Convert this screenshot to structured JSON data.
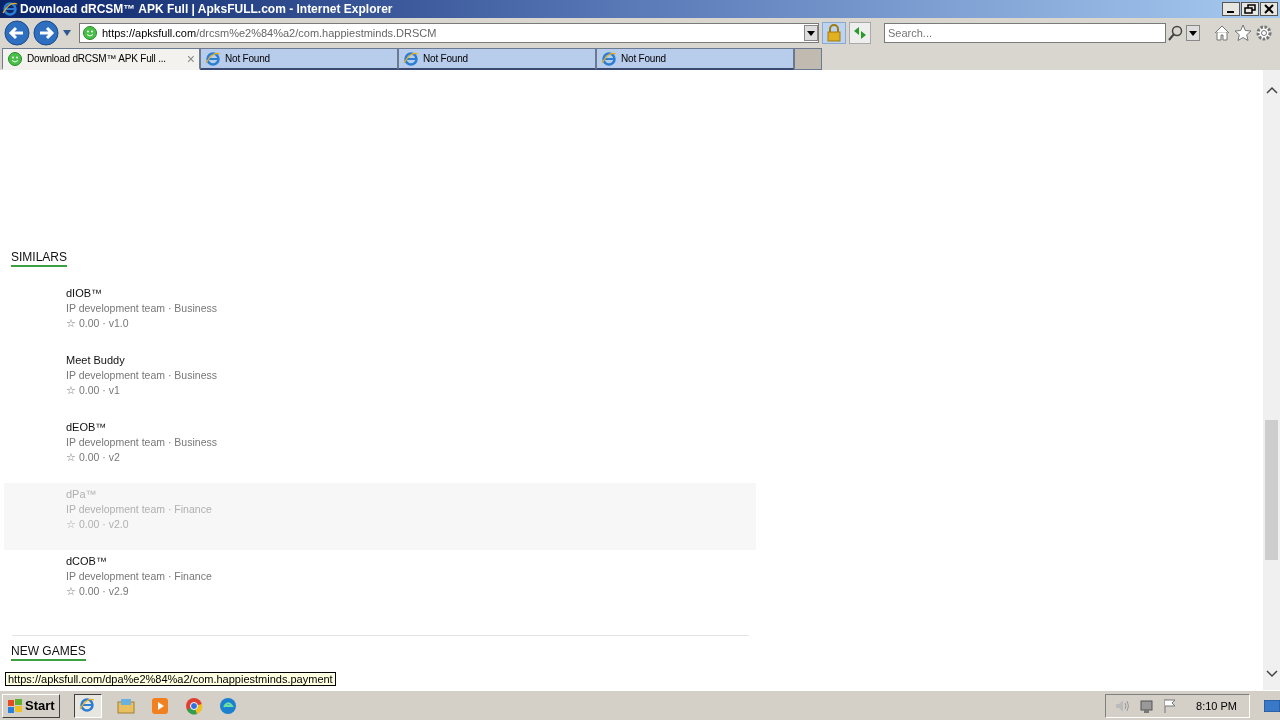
{
  "window": {
    "title": "Download dRCSM™ APK Full | ApksFULL.com - Internet Explorer"
  },
  "address": {
    "host": "https://apksfull.com",
    "path": "/drcsm%e2%84%a2/com.happiestminds.DRSCM"
  },
  "search": {
    "placeholder": "Search..."
  },
  "tabs": [
    {
      "label": "Download dRCSM™ APK Full ...",
      "selected": true,
      "close": "×"
    },
    {
      "label": "Not Found",
      "selected": false
    },
    {
      "label": "Not Found",
      "selected": false
    },
    {
      "label": "Not Found",
      "selected": false
    }
  ],
  "similars": {
    "heading": "SIMILARS",
    "items": [
      {
        "name": "dIOB™",
        "meta": "IP development team · Business",
        "rating": "☆ 0.00 · v1.0",
        "hovered": false
      },
      {
        "name": "Meet Buddy",
        "meta": "IP development team · Business",
        "rating": "☆ 0.00 · v1",
        "hovered": false
      },
      {
        "name": "dEOB™",
        "meta": "IP development team · Business",
        "rating": "☆ 0.00 · v2",
        "hovered": false
      },
      {
        "name": "dPa™",
        "meta": "IP development team · Finance",
        "rating": "☆ 0.00 · v2.0",
        "hovered": true
      },
      {
        "name": "dCOB™",
        "meta": "IP development team · Finance",
        "rating": "☆ 0.00 · v2.9",
        "hovered": false
      }
    ]
  },
  "new_games": {
    "heading": "NEW GAMES"
  },
  "status_url": "https://apksfull.com/dpa%e2%84%a2/com.happiestminds.payment",
  "taskbar": {
    "start": "Start",
    "clock": "8:10 PM"
  }
}
